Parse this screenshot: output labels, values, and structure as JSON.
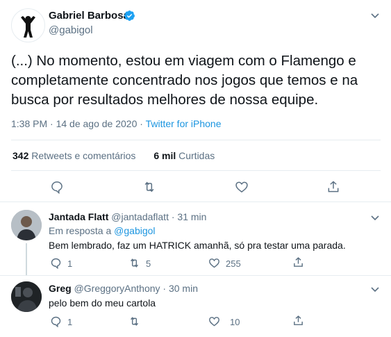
{
  "main_tweet": {
    "author_name": "Gabriel Barbosa",
    "author_handle": "@gabigol",
    "text_lines": [
      "(...) No momento, estou em viagem com o Flamengo e",
      "completamente concentrado nos jogos que temos e na",
      "busca por resultados melhores de nossa equipe."
    ],
    "time": "1:38 PM · 14 de ago de 2020 ·",
    "source": "Twitter for iPhone",
    "retweets_count": "342",
    "retweets_label": "Retweets e comentários",
    "likes_count": "6 mil",
    "likes_label": "Curtidas"
  },
  "replies": [
    {
      "name": "Jantada Flatt",
      "handle": "@jantadaflatt",
      "time": "· 31 min",
      "reply_to_prefix": "Em resposta a",
      "reply_to_handle": "@gabigol",
      "text": "Bem lembrado, faz um HATRICK amanhã, só pra testar uma parada.",
      "reply_count": "1",
      "retweet_count": "5",
      "like_count": "255"
    },
    {
      "name": "Greg",
      "handle": "@GreggoryAnthony",
      "time": "· 30 min",
      "text": "pelo bem do meu cartola",
      "reply_count": "1",
      "retweet_count": "",
      "like_count": "10"
    }
  ],
  "colors": {
    "link": "#1b95e0",
    "muted": "#5b7083",
    "verified": "#1da1f2",
    "divider": "#e6ecf0"
  }
}
